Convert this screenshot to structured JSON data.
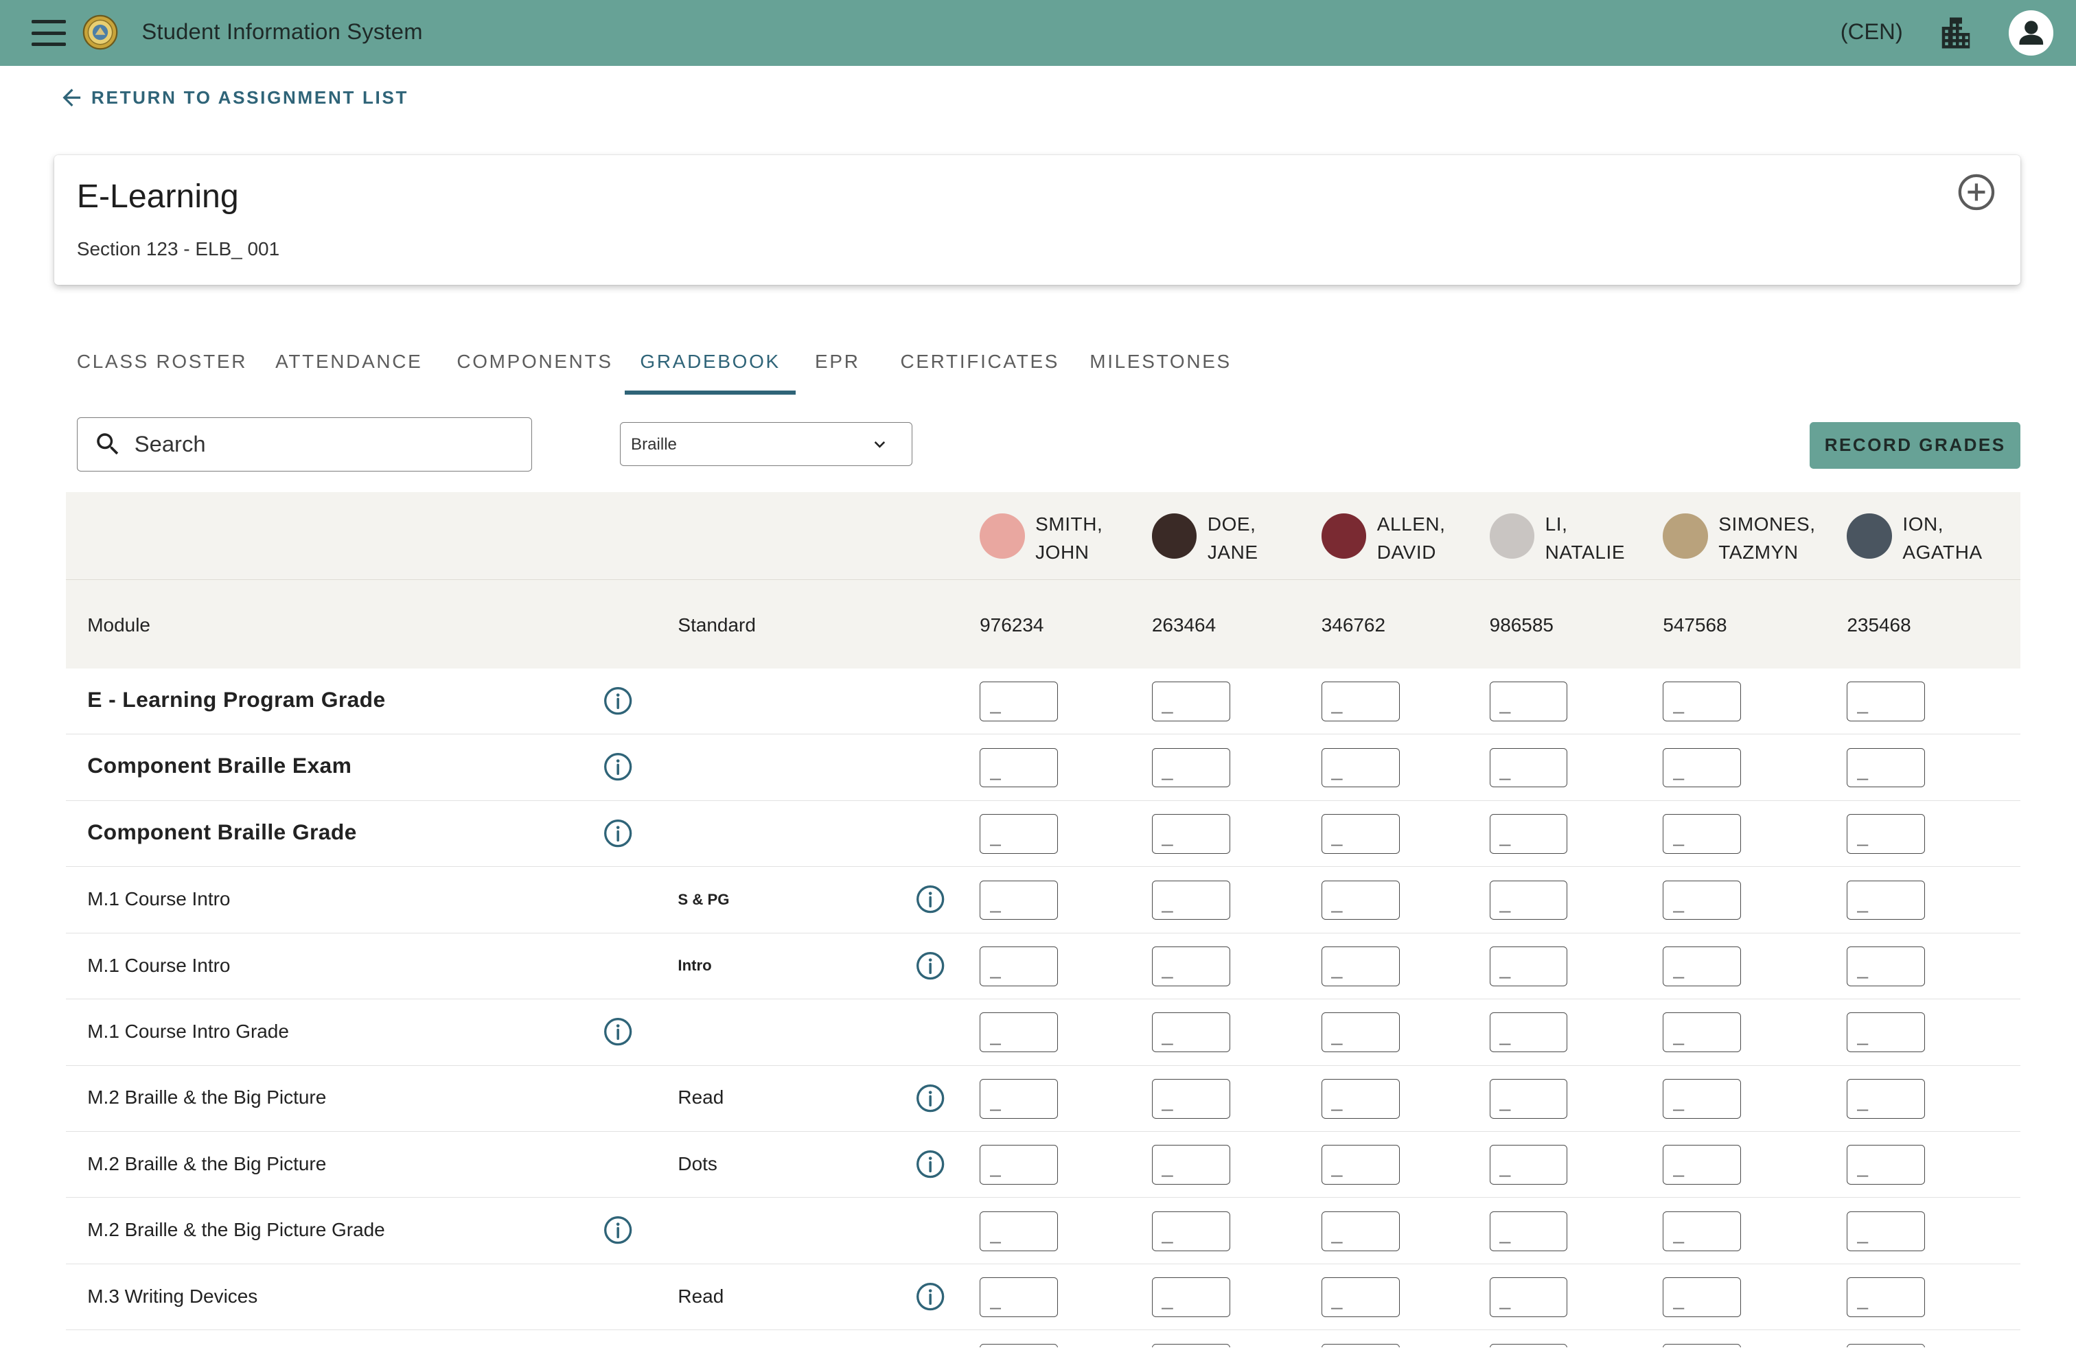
{
  "app": {
    "title": "Student Information System",
    "timezone": "(CEN)"
  },
  "nav": {
    "back_label": "RETURN TO ASSIGNMENT LIST"
  },
  "course": {
    "title": "E-Learning",
    "section": "Section 123 - ELB_ 001"
  },
  "tabs": [
    {
      "label": "CLASS ROSTER",
      "active": false
    },
    {
      "label": "ATTENDANCE",
      "active": false
    },
    {
      "label": "COMPONENTS",
      "active": false
    },
    {
      "label": "GRADEBOOK",
      "active": true
    },
    {
      "label": "EPR",
      "active": false
    },
    {
      "label": "CERTIFICATES",
      "active": false
    },
    {
      "label": "MILESTONES",
      "active": false
    }
  ],
  "toolbar": {
    "search_placeholder": "Search",
    "filter_value": "Braille",
    "record_label": "RECORD GRADES"
  },
  "table": {
    "module_header": "Module",
    "standard_header": "Standard",
    "students": [
      {
        "last": "SMITH,",
        "first": "JOHN",
        "id": "976234",
        "avatar_color": "#e9a7a0"
      },
      {
        "last": "DOE,",
        "first": "JANE",
        "id": "263464",
        "avatar_color": "#3a2a26"
      },
      {
        "last": "ALLEN,",
        "first": "DAVID",
        "id": "346762",
        "avatar_color": "#7a2a32"
      },
      {
        "last": "LI,",
        "first": "NATALIE",
        "id": "986585",
        "avatar_color": "#c9c5c2"
      },
      {
        "last": "SIMONES,",
        "first": "TAZMYN",
        "id": "547568",
        "avatar_color": "#b9a27c"
      },
      {
        "last": "ION,",
        "first": "AGATHA",
        "id": "235468",
        "avatar_color": "#4a5560"
      }
    ],
    "rows": [
      {
        "module": "E - Learning Program Grade",
        "standard": "",
        "style": "bold",
        "info": "module"
      },
      {
        "module": "Component Braille Exam",
        "standard": "",
        "style": "bold",
        "info": "module"
      },
      {
        "module": "Component Braille Grade",
        "standard": "",
        "style": "bold",
        "info": "module"
      },
      {
        "module": "M.1 Course Intro",
        "standard": "S & PG",
        "style": "small",
        "info": "standard"
      },
      {
        "module": "M.1 Course Intro",
        "standard": "Intro",
        "style": "small",
        "info": "standard"
      },
      {
        "module": "M.1 Course Intro Grade",
        "standard": "",
        "style": "normal",
        "info": "module"
      },
      {
        "module": "M.2 Braille & the Big Picture",
        "standard": "Read",
        "style": "normal",
        "info": "standard"
      },
      {
        "module": "M.2 Braille & the Big Picture",
        "standard": "Dots",
        "style": "normal",
        "info": "standard"
      },
      {
        "module": "M.2 Braille & the Big Picture Grade",
        "standard": "",
        "style": "normal",
        "info": "module"
      },
      {
        "module": "M.3 Writing Devices",
        "standard": "Read",
        "style": "normal",
        "info": "standard"
      },
      {
        "module": "",
        "standard": "",
        "style": "normal",
        "info": "standard"
      }
    ],
    "grade_placeholder": "_"
  },
  "colors": {
    "brand": "#67a296",
    "accent": "#2f6478"
  }
}
